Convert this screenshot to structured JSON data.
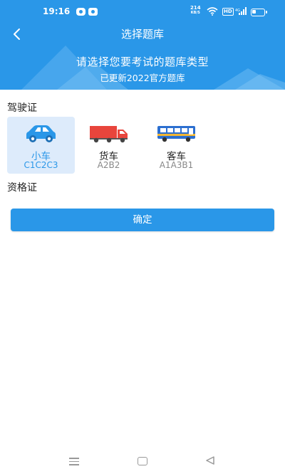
{
  "status_bar": {
    "time": "19:16",
    "net_speed_value": "214",
    "net_speed_unit": "KB/S",
    "hd_label": "HD"
  },
  "header": {
    "title": "选择题库",
    "banner_text": "请选择您要考试的题库类型",
    "banner_subtext": "已更新2022官方题库"
  },
  "sections": {
    "license_title": "驾驶证",
    "certificate_title": "资格证"
  },
  "vehicle_types": [
    {
      "name": "小车",
      "code": "C1C2C3",
      "icon": "car-icon",
      "selected": true
    },
    {
      "name": "货车",
      "code": "A2B2",
      "icon": "truck-icon",
      "selected": false
    },
    {
      "name": "客车",
      "code": "A1A3B1",
      "icon": "bus-icon",
      "selected": false
    }
  ],
  "confirm_label": "确定",
  "colors": {
    "primary": "#2a97e8",
    "selected_bg": "#ddebfb",
    "truck_red": "#e8453c",
    "bus_blue": "#2c6fd0"
  }
}
